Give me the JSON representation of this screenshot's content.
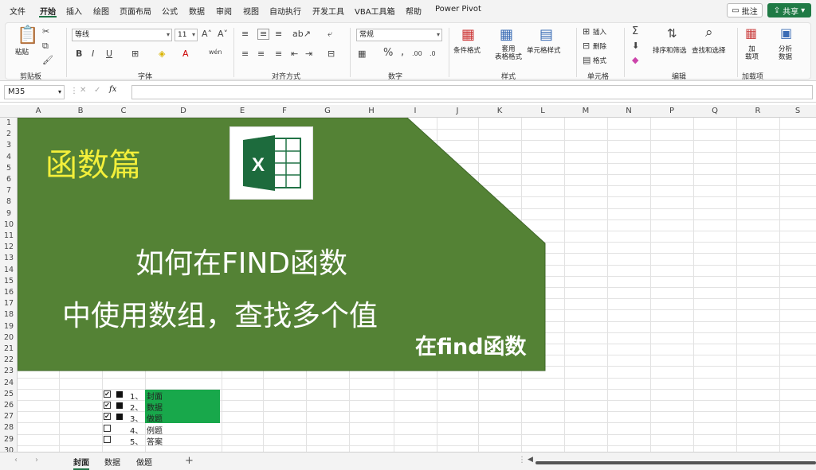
{
  "menu": [
    "文件",
    "开始",
    "插入",
    "绘图",
    "页面布局",
    "公式",
    "数据",
    "审阅",
    "视图",
    "自动执行",
    "开发工具",
    "VBA工具箱",
    "帮助",
    "Power Pivot"
  ],
  "comment_label": "批注",
  "share_label": "共享",
  "ribbon": {
    "paste": "粘贴",
    "font_name": "等线",
    "font_size": "11",
    "number_format": "常规",
    "conditional_format": "条件格式",
    "table_format": "套用\n表格格式",
    "cell_style": "单元格样式",
    "insert": "插入",
    "delete": "删除",
    "format": "格式",
    "sort_filter": "排序和筛选",
    "find_select": "查找和选择",
    "addins": "加\n载项",
    "analyze": "分析\n数据",
    "groups": {
      "clipboard": "剪贴板",
      "font": "字体",
      "alignment": "对齐方式",
      "number": "数字",
      "styles": "样式",
      "cells": "单元格",
      "editing": "编辑",
      "addins": "加载项"
    }
  },
  "name_box": "M35",
  "columns": [
    "A",
    "B",
    "C",
    "D",
    "E",
    "F",
    "G",
    "H",
    "I",
    "J",
    "K",
    "L",
    "M",
    "N",
    "P",
    "Q",
    "R",
    "S"
  ],
  "rows": [
    "1",
    "2",
    "3",
    "4",
    "5",
    "6",
    "7",
    "8",
    "9",
    "10",
    "11",
    "12",
    "13",
    "14",
    "15",
    "16",
    "17",
    "18",
    "19",
    "20",
    "21",
    "22",
    "23",
    "24",
    "25",
    "26",
    "27",
    "28",
    "29",
    "30"
  ],
  "cover": {
    "title": "函数篇",
    "line1": "如何在FIND函数",
    "line2": "中使用数组，查找多个值",
    "overlay": "在find函数"
  },
  "toc": [
    {
      "num": "1、",
      "label": "封面",
      "checked": true
    },
    {
      "num": "2、",
      "label": "数据",
      "checked": true
    },
    {
      "num": "3、",
      "label": "做题",
      "checked": true
    },
    {
      "num": "4、",
      "label": "例题",
      "checked": false
    },
    {
      "num": "5、",
      "label": "答案",
      "checked": false
    }
  ],
  "sheets": [
    "封面",
    "数据",
    "做题"
  ],
  "colors": {
    "excel_green": "#217346",
    "cover_green": "#548235",
    "toc_highlight": "#18a84b",
    "title_yellow": "#f3ef3a"
  }
}
